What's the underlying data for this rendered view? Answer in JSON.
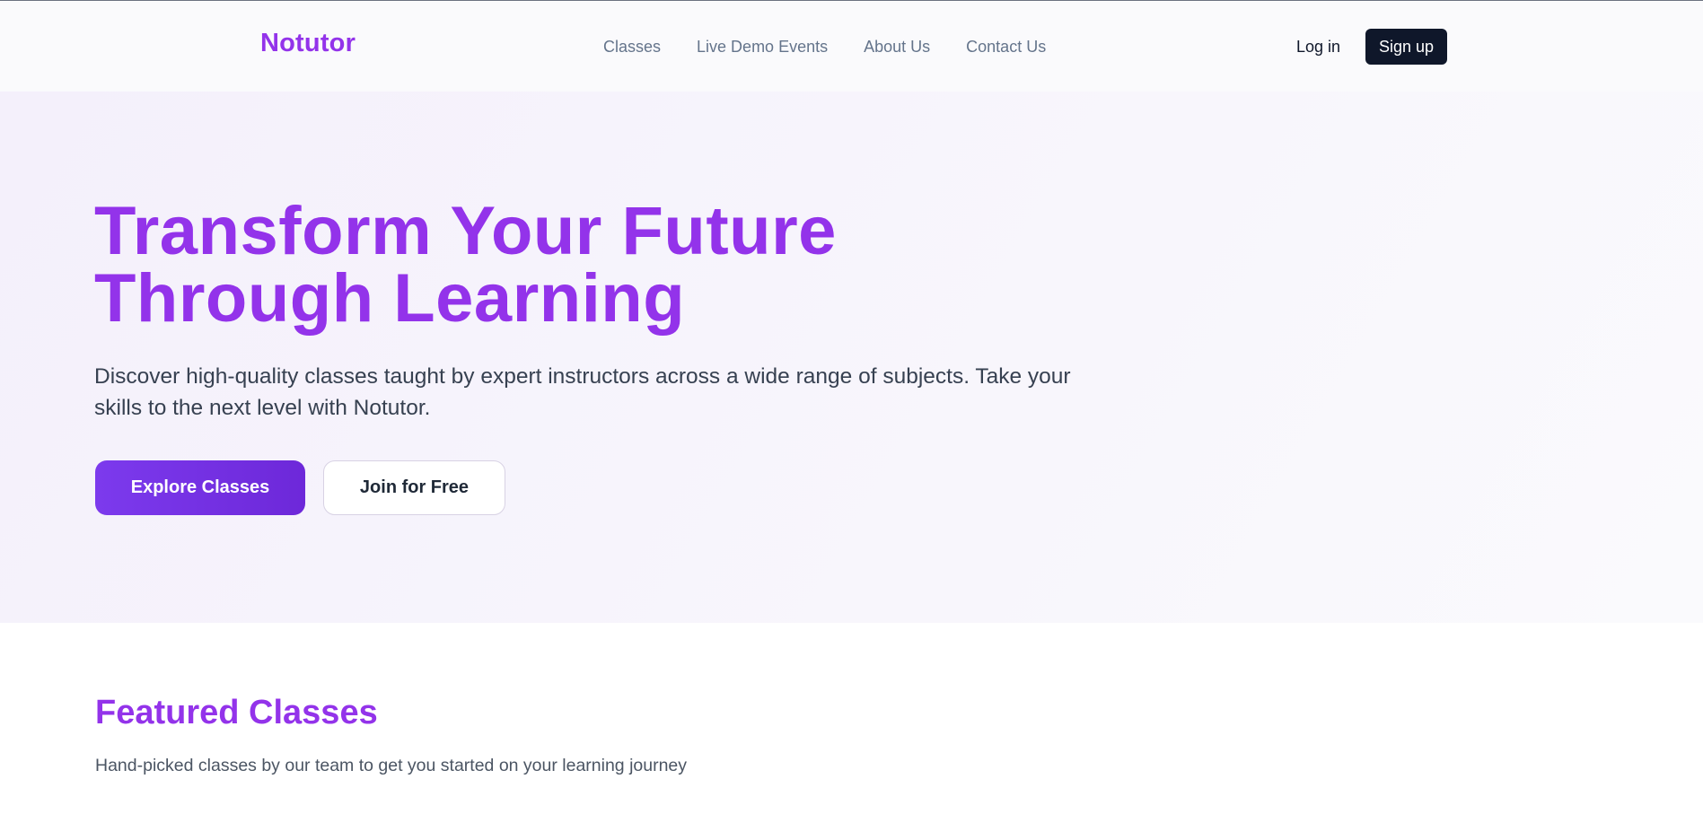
{
  "header": {
    "logo": "Notutor",
    "nav": [
      {
        "label": "Classes"
      },
      {
        "label": "Live Demo Events"
      },
      {
        "label": "About Us"
      },
      {
        "label": "Contact Us"
      }
    ],
    "login_label": "Log in",
    "signup_label": "Sign up"
  },
  "hero": {
    "title_line1": "Transform Your Future",
    "title_line2": "Through Learning",
    "description": "Discover high-quality classes taught by expert instructors across a wide range of subjects. Take your skills to the next level with Notutor.",
    "primary_button": "Explore Classes",
    "secondary_button": "Join for Free"
  },
  "featured": {
    "title": "Featured Classes",
    "subtitle": "Hand-picked classes by our team to get you started on your learning journey"
  },
  "colors": {
    "brand": "#9333ea",
    "primary_button": "#7c3aed",
    "dark_button": "#0f172a",
    "hero_background": "#f4f0fb"
  }
}
